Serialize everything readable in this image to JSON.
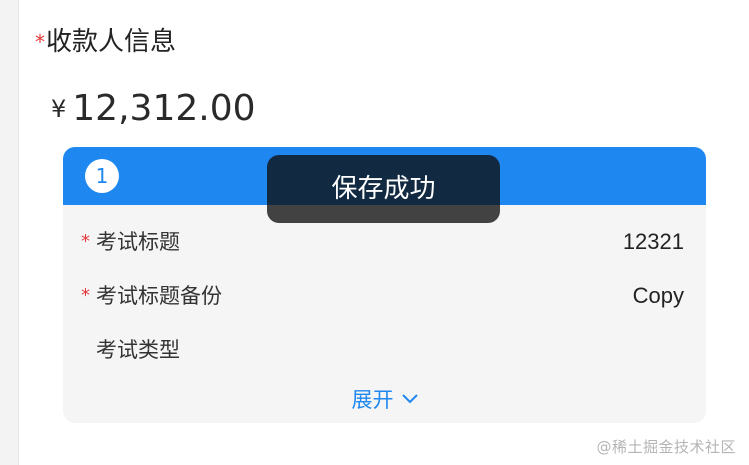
{
  "section": {
    "required_mark": "*",
    "title": "收款人信息"
  },
  "amount": {
    "currency": "¥",
    "value": "12,312.00"
  },
  "card": {
    "index": "1",
    "header_color": "#1e88f0",
    "fields": [
      {
        "required": "*",
        "label": "考试标题",
        "value": "12321"
      },
      {
        "required": "*",
        "label": "考试标题备份",
        "value": "Copy"
      },
      {
        "required": "",
        "label": "考试类型",
        "value": ""
      }
    ],
    "expand_label": "展开"
  },
  "toast": {
    "message": "保存成功"
  },
  "watermark": "@稀土掘金技术社区",
  "icons": {
    "expand": "chevron-down-icon"
  },
  "colors": {
    "accent": "#1e88f0",
    "required": "#e4393c"
  }
}
